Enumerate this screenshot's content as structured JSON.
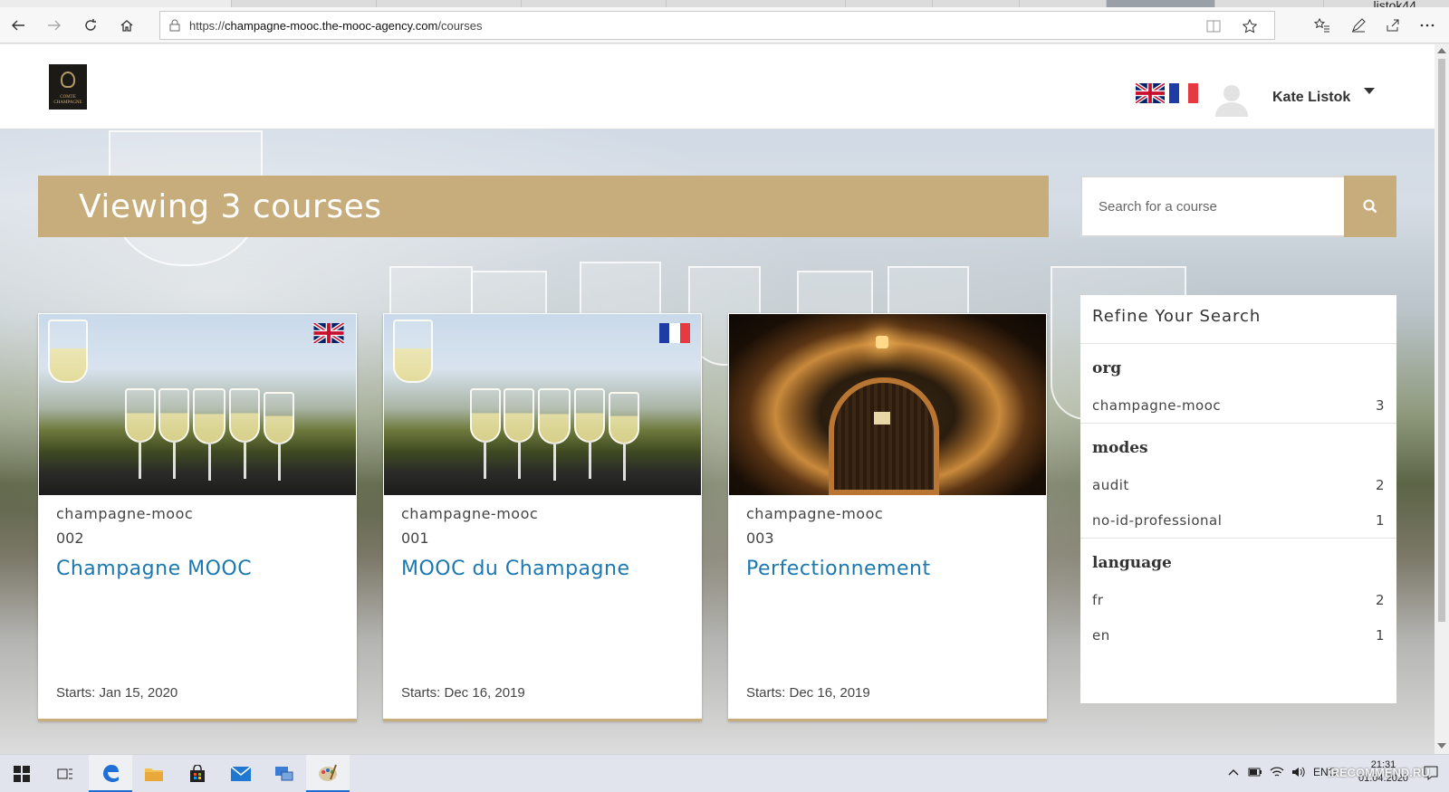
{
  "browser": {
    "window_user": "listok44",
    "url_prefix": "https://",
    "url_host": "champagne-mooc.the-mooc-agency.com",
    "url_path": "/courses"
  },
  "header": {
    "logo_text": "COMTE CHAMPAGNE",
    "user_name": "Kate Listok"
  },
  "banner": {
    "title": "Viewing 3 courses"
  },
  "search": {
    "placeholder": "Search for a course"
  },
  "courses": [
    {
      "org": "champagne-mooc",
      "number": "002",
      "title": "Champagne MOOC",
      "start": "Starts: Jan 15, 2020",
      "language_flag": "uk-flag"
    },
    {
      "org": "champagne-mooc",
      "number": "001",
      "title": "MOOC du Champagne",
      "start": "Starts: Dec 16, 2019",
      "language_flag": "fr-flag"
    },
    {
      "org": "champagne-mooc",
      "number": "003",
      "title": "Perfectionnement",
      "start": "Starts: Dec 16, 2019",
      "language_flag": ""
    }
  ],
  "refine": {
    "title": "Refine Your Search",
    "facets": [
      {
        "name": "org",
        "items": [
          {
            "label": "champagne-mooc",
            "count": "3"
          }
        ]
      },
      {
        "name": "modes",
        "items": [
          {
            "label": "audit",
            "count": "2"
          },
          {
            "label": "no-id-professional",
            "count": "1"
          }
        ]
      },
      {
        "name": "language",
        "items": [
          {
            "label": "fr",
            "count": "2"
          },
          {
            "label": "en",
            "count": "1"
          }
        ]
      }
    ]
  },
  "taskbar": {
    "lang": "ENG",
    "time": "21:31",
    "date": "01.04.2020",
    "watermark": "iRECOMMEND.RU"
  },
  "colors": {
    "accent_gold": "#c6ad7b",
    "link_blue": "#1b78b0"
  }
}
